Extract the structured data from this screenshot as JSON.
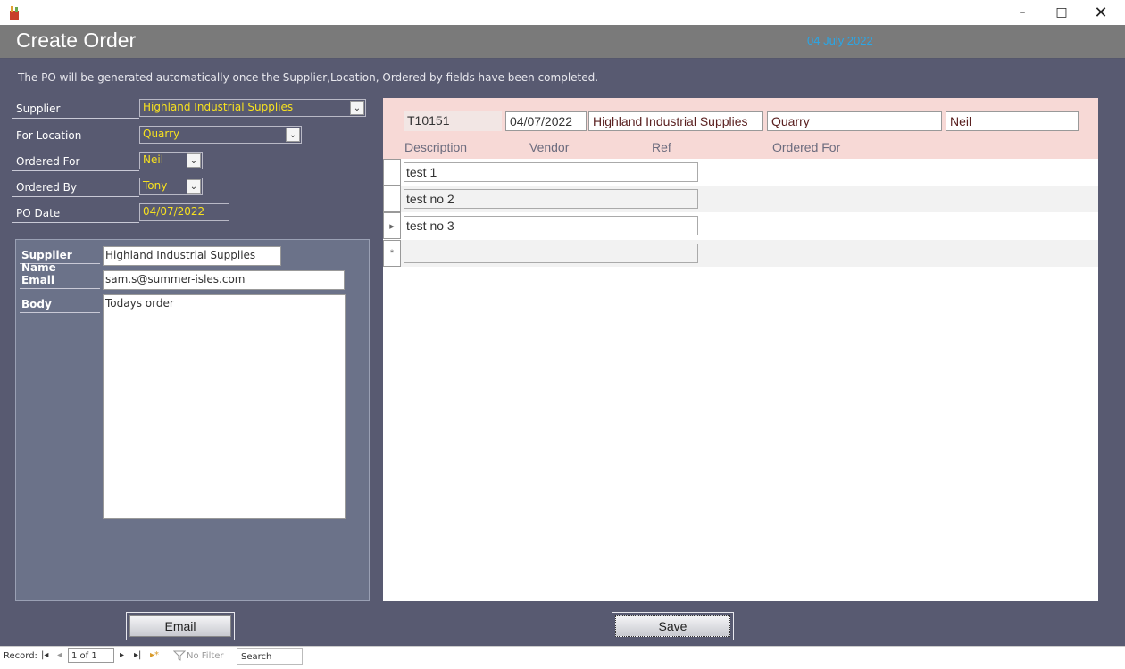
{
  "window": {
    "minimize_glyph": "–",
    "maximize_glyph": "□",
    "close_glyph": "✕"
  },
  "header": {
    "title": "Create Order",
    "date": "04 July 2022"
  },
  "info_text": "The PO will be generated automatically once the Supplier,Location, Ordered by fields have been completed.",
  "fields": {
    "supplier": {
      "label": "Supplier",
      "value": "Highland Industrial Supplies"
    },
    "location": {
      "label": "For Location",
      "value": "Quarry"
    },
    "ordered_for": {
      "label": "Ordered For",
      "value": "Neil"
    },
    "ordered_by": {
      "label": "Ordered By",
      "value": "Tony"
    },
    "po_date": {
      "label": "PO Date",
      "value": "04/07/2022"
    }
  },
  "email_panel": {
    "supplier_name_label": "Supplier Name",
    "supplier_name": "Highland Industrial Supplies",
    "email_label": "Email",
    "email": "sam.s@summer-isles.com",
    "body_label": "Body",
    "body": "Todays order"
  },
  "order_header": {
    "po_number": "T10151",
    "date": "04/07/2022",
    "supplier": "Highland Industrial Supplies",
    "location": "Quarry",
    "ordered_for": "Neil"
  },
  "columns": [
    "Description",
    "Vendor",
    "Ref",
    "Ordered For"
  ],
  "rows": [
    {
      "description": "test 1",
      "selector": ""
    },
    {
      "description": "test no 2",
      "selector": ""
    },
    {
      "description": "test no 3",
      "selector": "▸"
    },
    {
      "description": "",
      "selector": "*"
    }
  ],
  "buttons": {
    "email": "Email",
    "save": "Save"
  },
  "statusbar": {
    "record_label": "Record:",
    "first": "|◂",
    "prev": "◂",
    "position": "1 of 1",
    "next": "▸",
    "last": "▸|",
    "new": "▸*",
    "filter": "No Filter",
    "search": "Search"
  },
  "colors": {
    "background": "#585a71",
    "accent_text": "#f7e11f",
    "date": "#2aa6e6",
    "subheader": "#f7d9d6"
  }
}
